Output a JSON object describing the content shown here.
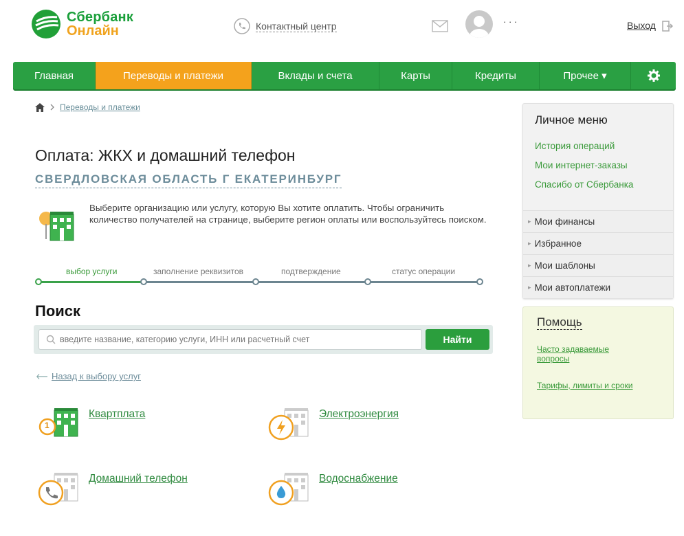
{
  "header": {
    "logo_line1": "Сбербанк",
    "logo_line2": "Онлайн",
    "contact_label": "Контактный центр",
    "username": "· · ·",
    "logout_label": "Выход"
  },
  "nav": {
    "items": [
      {
        "label": "Главная"
      },
      {
        "label": "Переводы и платежи"
      },
      {
        "label": "Вклады и счета"
      },
      {
        "label": "Карты"
      },
      {
        "label": "Кредиты"
      },
      {
        "label": "Прочее ▾"
      }
    ],
    "active_index": 1
  },
  "breadcrumb": {
    "current": "Переводы и платежи"
  },
  "page": {
    "title": "Оплата: ЖКХ и домашний телефон",
    "region": "СВЕРДЛОВСКАЯ ОБЛАСТЬ Г ЕКАТЕРИНБУРГ",
    "intro": "Выберите организацию или услугу, которую Вы хотите оплатить. Чтобы ограничить количество получателей на странице, выберите регион оплаты или воспользуйтесь поиском."
  },
  "steps": [
    {
      "label": "выбор услуги",
      "active": true
    },
    {
      "label": "заполнение реквизитов",
      "active": false
    },
    {
      "label": "подтверждение",
      "active": false
    },
    {
      "label": "статус операции",
      "active": false
    }
  ],
  "search": {
    "title": "Поиск",
    "placeholder": "введите название, категорию услуги, ИНН или расчетный счет",
    "button_label": "Найти"
  },
  "back_link": "Назад к выбору услуг",
  "services": [
    {
      "label": "Квартплата",
      "badge": "1"
    },
    {
      "label": "Электроэнергия"
    },
    {
      "label": "Домашний телефон"
    },
    {
      "label": "Водоснабжение"
    }
  ],
  "personal_menu": {
    "title": "Личное меню",
    "links": [
      "История операций",
      "Мои интернет-заказы",
      "Спасибо от Сбербанка"
    ],
    "sections": [
      "Мои финансы",
      "Избранное",
      "Мои шаблоны",
      "Мои автоплатежи"
    ]
  },
  "help": {
    "title": "Помощь",
    "links": [
      "Часто задаваемые вопросы",
      "Тарифы, лимиты и сроки"
    ]
  },
  "colors": {
    "brand_green": "#2aa043",
    "accent_orange": "#f4a21c",
    "link_green": "#3a9a3a",
    "muted_blue": "#6c8c9a"
  }
}
